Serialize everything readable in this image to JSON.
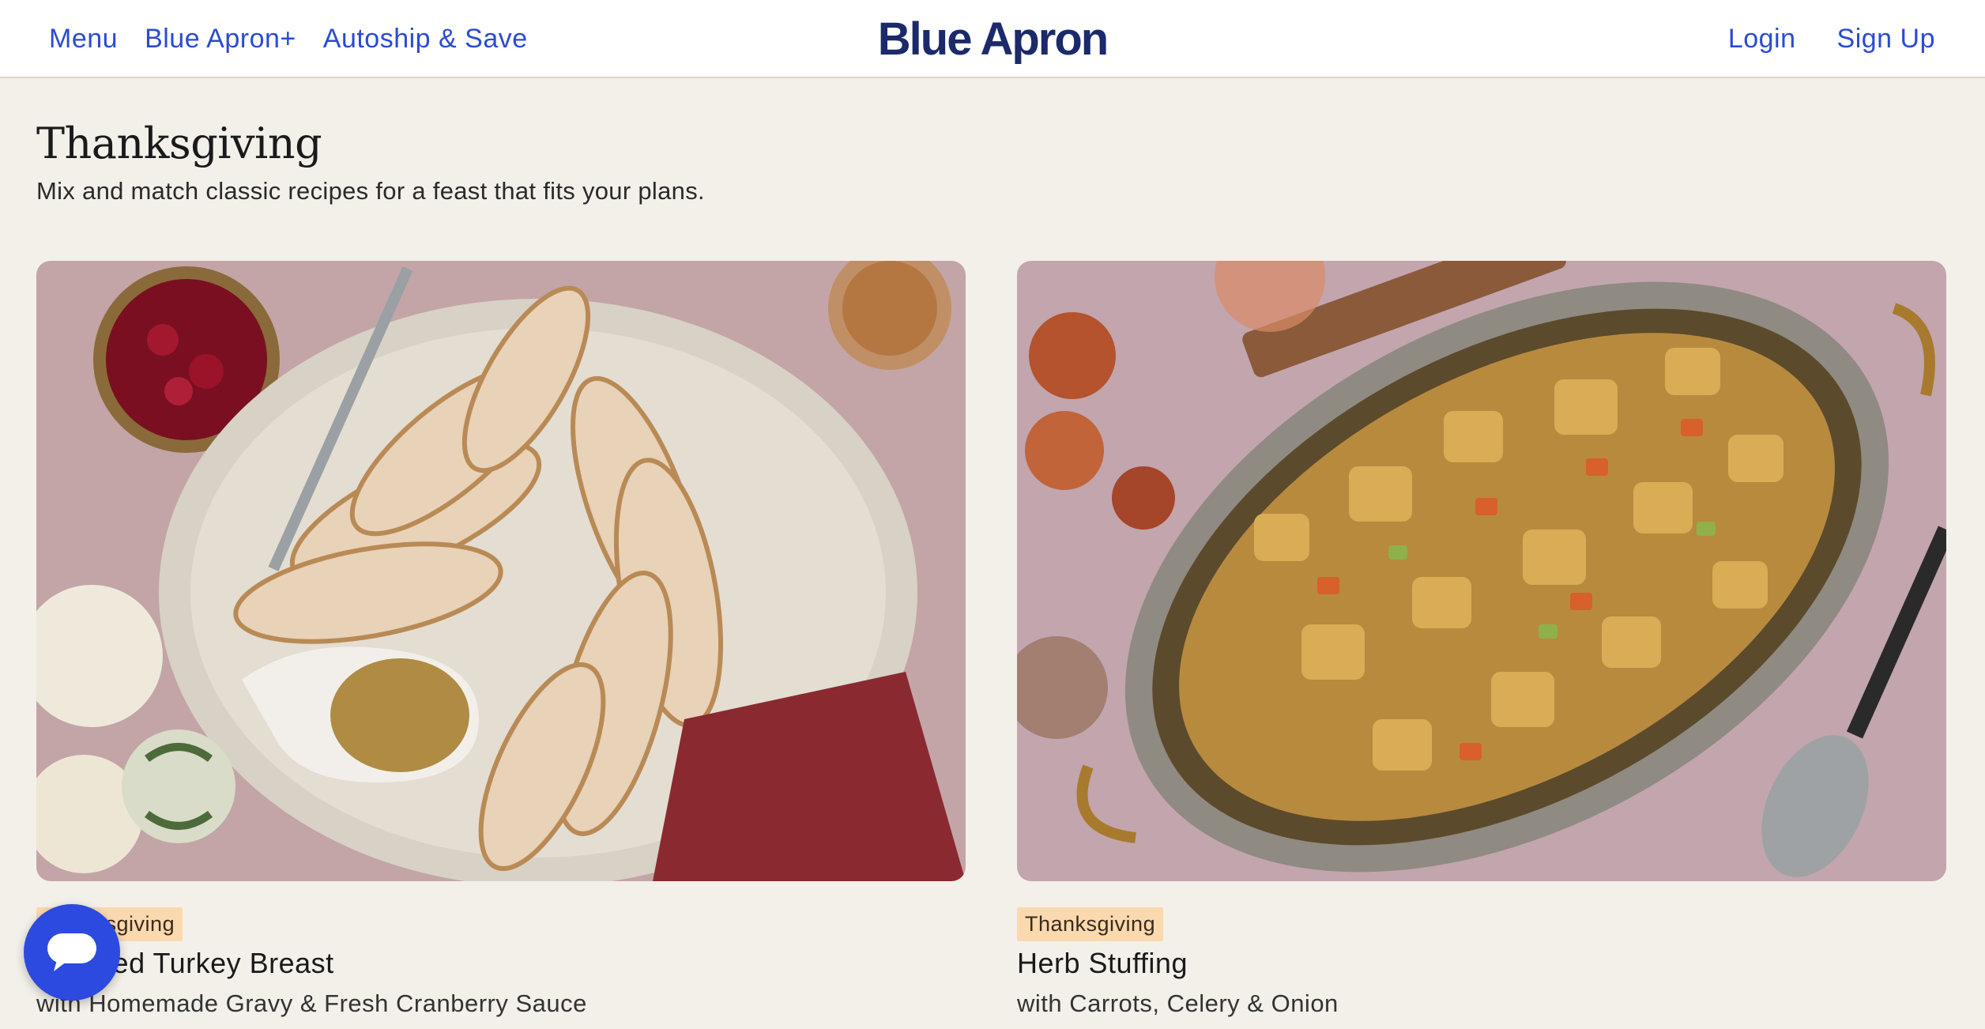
{
  "header": {
    "nav_left": [
      "Menu",
      "Blue Apron+",
      "Autoship & Save"
    ],
    "logo": "Blue Apron",
    "nav_right": [
      "Login",
      "Sign Up"
    ]
  },
  "section": {
    "title": "Thanksgiving",
    "subtitle": "Mix and match classic recipes for a feast that fits your plans."
  },
  "cards": [
    {
      "tag": "Thanksgiving",
      "title": "Roasted Turkey Breast",
      "description": "with Homemade Gravy & Fresh Cranberry Sauce",
      "image": "turkey-platter-photo"
    },
    {
      "tag": "Thanksgiving",
      "title": "Herb Stuffing",
      "description": "with Carrots, Celery & Onion",
      "image": "stuffing-pan-photo"
    }
  ],
  "chat": {
    "icon": "chat-bubble-icon"
  },
  "colors": {
    "brand_blue": "#2b4bd1",
    "logo_navy": "#1b2a6b",
    "page_bg": "#f3f0ea",
    "tag_bg": "#fbd9ae",
    "chat_button": "#2c4ae0"
  }
}
